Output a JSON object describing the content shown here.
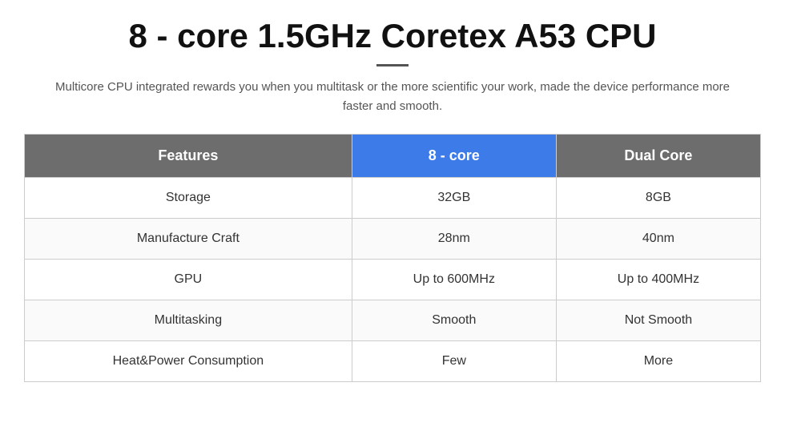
{
  "title": "8 - core 1.5GHz Coretex A53 CPU",
  "subtitle": "Multicore CPU integrated rewards you when you multitask or the more scientific your work, made the device performance more faster and smooth.",
  "table": {
    "headers": {
      "features": "Features",
      "col1": "8 - core",
      "col2": "Dual Core"
    },
    "rows": [
      {
        "feature": "Storage",
        "col1": "32GB",
        "col2": "8GB"
      },
      {
        "feature": "Manufacture Craft",
        "col1": "28nm",
        "col2": "40nm"
      },
      {
        "feature": "GPU",
        "col1": "Up to 600MHz",
        "col2": "Up to 400MHz"
      },
      {
        "feature": "Multitasking",
        "col1": "Smooth",
        "col2": "Not Smooth"
      },
      {
        "feature": "Heat&Power Consumption",
        "col1": "Few",
        "col2": "More"
      }
    ]
  }
}
